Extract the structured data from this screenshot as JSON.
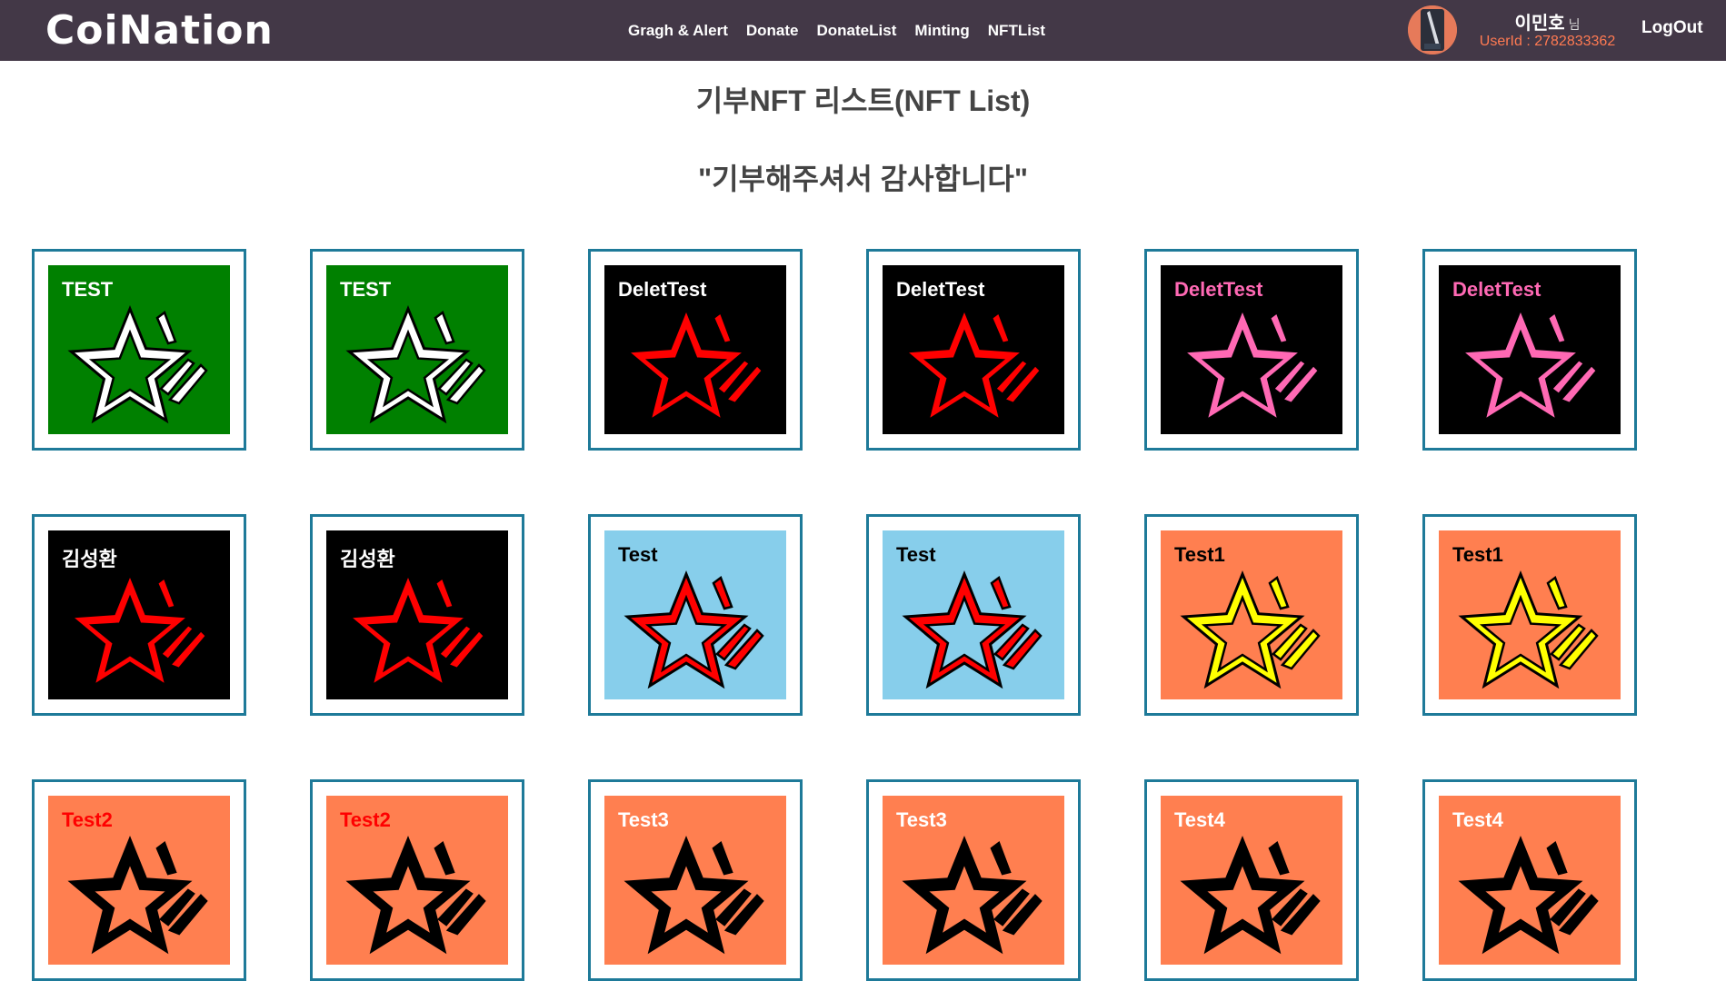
{
  "header": {
    "logo": "CoiNation",
    "nav": [
      "Gragh & Alert",
      "Donate",
      "DonateList",
      "Minting",
      "NFTList"
    ],
    "user_name": "이민호",
    "user_suffix": "님",
    "user_id": "UserId : 2782833362",
    "logout": "LogOut"
  },
  "main": {
    "title": "기부NFT 리스트(NFT List)",
    "subtitle": "\"기부해주셔서 감사합니다\""
  },
  "nft_cards": [
    {
      "title": "TEST",
      "bg": "#008000",
      "title_color": "#ffffff",
      "star_fill": "#ffffff",
      "star_inner": "#008000"
    },
    {
      "title": "TEST",
      "bg": "#008000",
      "title_color": "#ffffff",
      "star_fill": "#ffffff",
      "star_inner": "#008000"
    },
    {
      "title": "DeletTest",
      "bg": "#000000",
      "title_color": "#ffffff",
      "star_fill": "#ff0000",
      "star_inner": "#000000"
    },
    {
      "title": "DeletTest",
      "bg": "#000000",
      "title_color": "#ffffff",
      "star_fill": "#ff0000",
      "star_inner": "#000000"
    },
    {
      "title": "DeletTest",
      "bg": "#000000",
      "title_color": "#ff69b4",
      "star_fill": "#ff69b4",
      "star_inner": "#000000"
    },
    {
      "title": "DeletTest",
      "bg": "#000000",
      "title_color": "#ff69b4",
      "star_fill": "#ff69b4",
      "star_inner": "#000000"
    },
    {
      "title": "김성환",
      "bg": "#000000",
      "title_color": "#ffffff",
      "star_fill": "#ff0000",
      "star_inner": "#000000"
    },
    {
      "title": "김성환",
      "bg": "#000000",
      "title_color": "#ffffff",
      "star_fill": "#ff0000",
      "star_inner": "#000000"
    },
    {
      "title": "Test",
      "bg": "#87ceeb",
      "title_color": "#000000",
      "star_fill": "#ff0000",
      "star_inner": "#87ceeb"
    },
    {
      "title": "Test",
      "bg": "#87ceeb",
      "title_color": "#000000",
      "star_fill": "#ff0000",
      "star_inner": "#87ceeb"
    },
    {
      "title": "Test1",
      "bg": "#ff7f50",
      "title_color": "#000000",
      "star_fill": "#ffff00",
      "star_inner": "#ff7f50"
    },
    {
      "title": "Test1",
      "bg": "#ff7f50",
      "title_color": "#000000",
      "star_fill": "#ffff00",
      "star_inner": "#ff7f50"
    },
    {
      "title": "Test2",
      "bg": "#ff7f50",
      "title_color": "#ff0000",
      "star_fill": "#000000",
      "star_inner": "#ff7f50"
    },
    {
      "title": "Test2",
      "bg": "#ff7f50",
      "title_color": "#ff0000",
      "star_fill": "#000000",
      "star_inner": "#ff7f50"
    },
    {
      "title": "Test3",
      "bg": "#ff7f50",
      "title_color": "#ffffff",
      "star_fill": "#000000",
      "star_inner": "#ff7f50"
    },
    {
      "title": "Test3",
      "bg": "#ff7f50",
      "title_color": "#ffffff",
      "star_fill": "#000000",
      "star_inner": "#ff7f50"
    },
    {
      "title": "Test4",
      "bg": "#ff7f50",
      "title_color": "#ffffff",
      "star_fill": "#000000",
      "star_inner": "#ff7f50"
    },
    {
      "title": "Test4",
      "bg": "#ff7f50",
      "title_color": "#ffffff",
      "star_fill": "#000000",
      "star_inner": "#ff7f50"
    }
  ]
}
